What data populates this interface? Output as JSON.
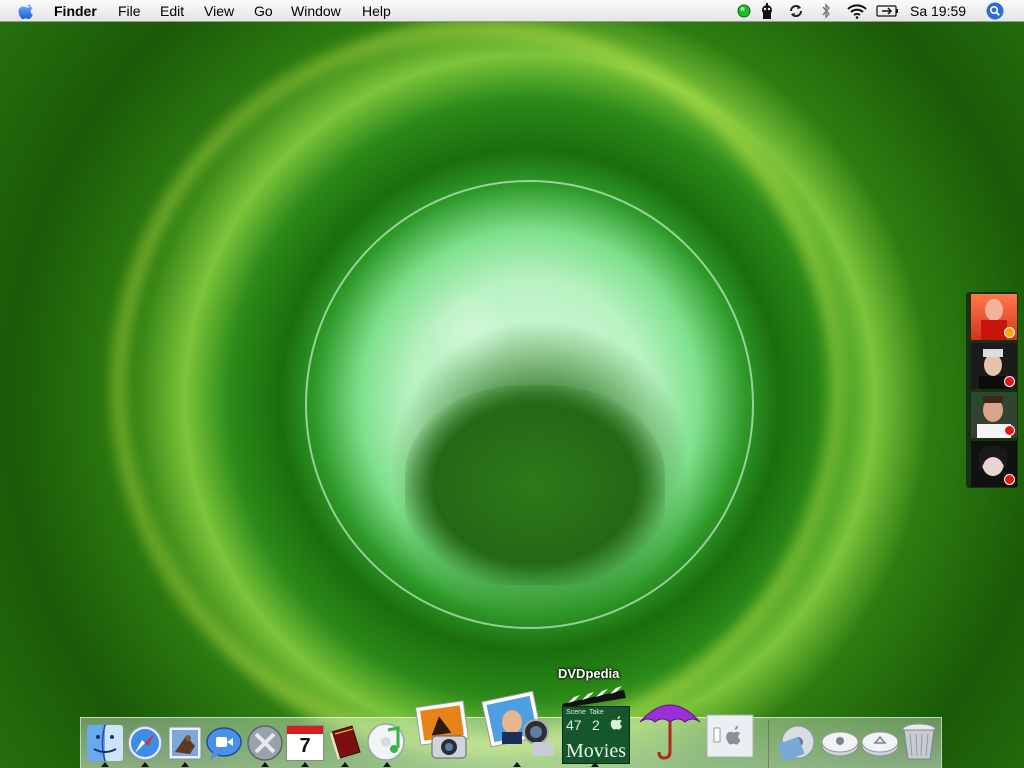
{
  "menubar": {
    "app_name": "Finder",
    "menus": [
      "File",
      "Edit",
      "View",
      "Go",
      "Window",
      "Help"
    ],
    "clock": "Sa 19:59"
  },
  "dock": {
    "hover_label": "DVDpedia",
    "movies_label": "Movies",
    "scene_text": "Scene",
    "take_text": "Take",
    "scene_number": "47",
    "take_number": "2",
    "calendar_day": "7"
  },
  "buddies": [
    {
      "status": "away",
      "status_color": "#f2a90a"
    },
    {
      "status": "busy",
      "status_color": "#e3170d"
    },
    {
      "status": "busy",
      "status_color": "#e3170d"
    },
    {
      "status": "busy",
      "status_color": "#e3170d"
    }
  ],
  "colors": {
    "menubar": "#f0f0f0",
    "selection_blue": "#2b6fd6",
    "status_green": "#1fbf2b"
  }
}
